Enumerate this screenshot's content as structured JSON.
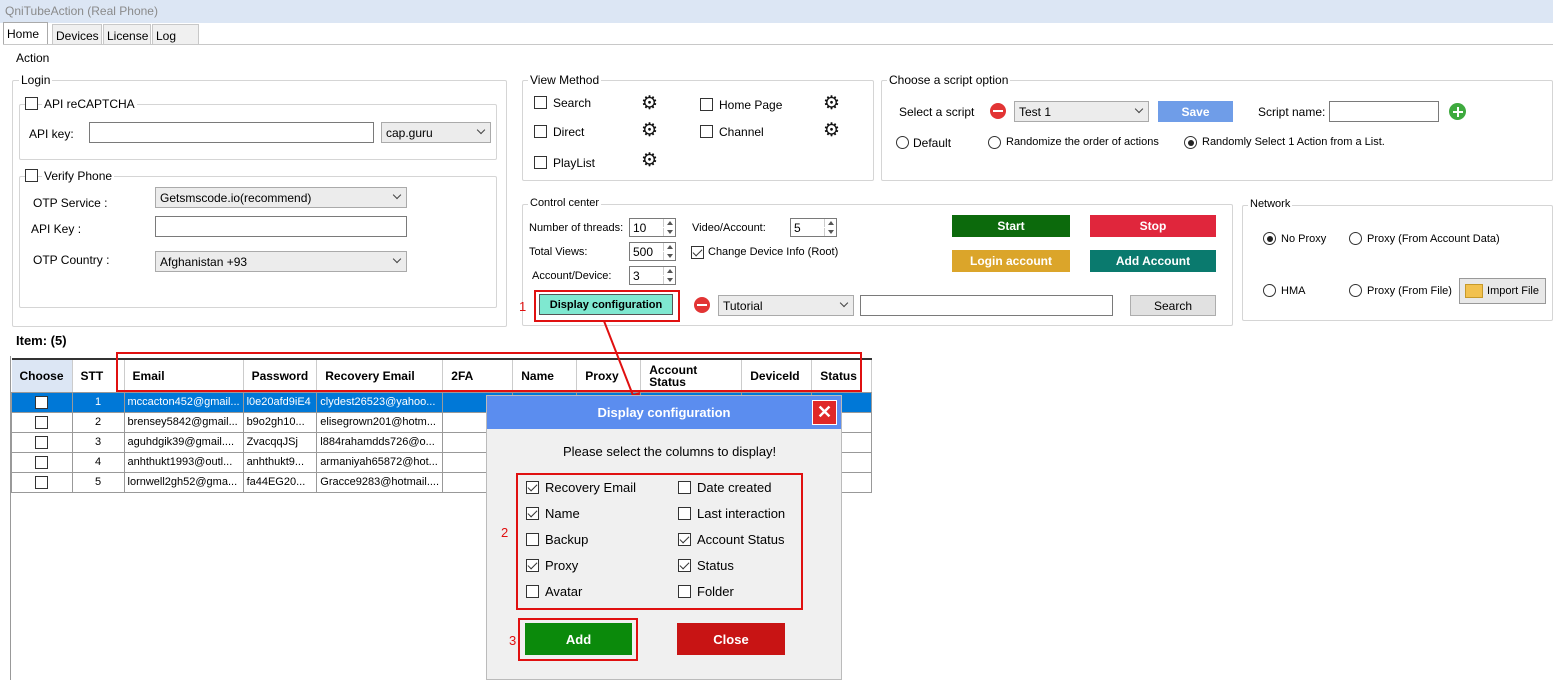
{
  "app": {
    "title": "QniTubeAction (Real Phone)"
  },
  "tabs": [
    "Home",
    "Devices",
    "License",
    "Log"
  ],
  "action_label": "Action",
  "login": {
    "label": "Login",
    "recaptcha_label": "API reCAPTCHA",
    "api_key_label": "API key:",
    "api_key_value": "",
    "captcha_service": "cap.guru",
    "verify_label": "Verify Phone",
    "otp_service_label": "OTP Service :",
    "otp_service_value": "Getsmscode.io(recommend)",
    "api_key2_label": "API Key :",
    "api_key2_value": "",
    "otp_country_label": "OTP Country :",
    "otp_country_value": "Afghanistan +93"
  },
  "view_method": {
    "label": "View Method",
    "search": "Search",
    "direct": "Direct",
    "playlist": "PlayList",
    "home_page": "Home Page",
    "channel": "Channel"
  },
  "script_option": {
    "label": "Choose a script option",
    "select_label": "Select a script",
    "script_value": "Test 1",
    "save": "Save",
    "script_name_label": "Script name:",
    "script_name_value": "",
    "default": "Default",
    "randomize": "Randomize the order of actions",
    "random_select": "Randomly Select 1 Action from a List."
  },
  "control": {
    "label": "Control center",
    "threads_label": "Number of threads:",
    "threads": "10",
    "views_label": "Total Views:",
    "views": "500",
    "account_device_label": "Account/Device:",
    "account_device": "3",
    "video_account_label": "Video/Account:",
    "video_account": "5",
    "change_device": "Change Device Info (Root)",
    "start": "Start",
    "stop": "Stop",
    "login_account": "Login account",
    "add_account": "Add Account",
    "display_config": "Display configuration",
    "tutorial": "Tutorial",
    "search_value": "",
    "search_btn": "Search"
  },
  "network": {
    "label": "Network",
    "no_proxy": "No Proxy",
    "proxy_account": "Proxy (From Account Data)",
    "hma": "HMA",
    "proxy_file": "Proxy (From File)",
    "import_file": "Import File"
  },
  "items_label": "Item: (5)",
  "table": {
    "headers": [
      "Choose",
      "STT",
      "Email",
      "Password",
      "Recovery Email",
      "2FA",
      "Name",
      "Proxy",
      "Account Status",
      "DeviceId",
      "Status"
    ],
    "rows": [
      {
        "stt": "1",
        "email": "mccacton452@gmail...",
        "password": "l0e20afd9iE4",
        "recovery": "clydest26523@yahoo..."
      },
      {
        "stt": "2",
        "email": "brensey5842@gmail...",
        "password": "b9o2gh10...",
        "recovery": "elisegrown201@hotm..."
      },
      {
        "stt": "3",
        "email": "aguhdgik39@gmail....",
        "password": "ZvacqqJSj",
        "recovery": "l884rahamdds726@o..."
      },
      {
        "stt": "4",
        "email": "anhthukt1993@outl...",
        "password": "anhthukt9...",
        "recovery": "armaniyah65872@hot..."
      },
      {
        "stt": "5",
        "email": "lornwell2gh52@gma...",
        "password": "fa44EG20...",
        "recovery": "Gracce9283@hotmail...."
      }
    ]
  },
  "dialog": {
    "title": "Display configuration",
    "close_x": "✕",
    "prompt": "Please select the columns to display!",
    "options_left": [
      {
        "label": "Recovery Email",
        "checked": true
      },
      {
        "label": "Name",
        "checked": true
      },
      {
        "label": "Backup",
        "checked": false
      },
      {
        "label": "Proxy",
        "checked": true
      },
      {
        "label": "Avatar",
        "checked": false
      }
    ],
    "options_right": [
      {
        "label": "Date created",
        "checked": false
      },
      {
        "label": "Last interaction",
        "checked": false
      },
      {
        "label": "Account Status",
        "checked": true
      },
      {
        "label": "Status",
        "checked": true
      },
      {
        "label": "Folder",
        "checked": false
      }
    ],
    "add": "Add",
    "close": "Close"
  },
  "annotations": [
    "1",
    "2",
    "3"
  ],
  "colors": {
    "start": "#0c6a0c",
    "stop": "#e0263c",
    "login": "#dba52a",
    "add_account": "#0a7a6e",
    "save": "#6f9de8",
    "display_config": "#7fe8d0",
    "add": "#0b8a0b",
    "close": "#c81414",
    "selection": "#0078d7"
  }
}
